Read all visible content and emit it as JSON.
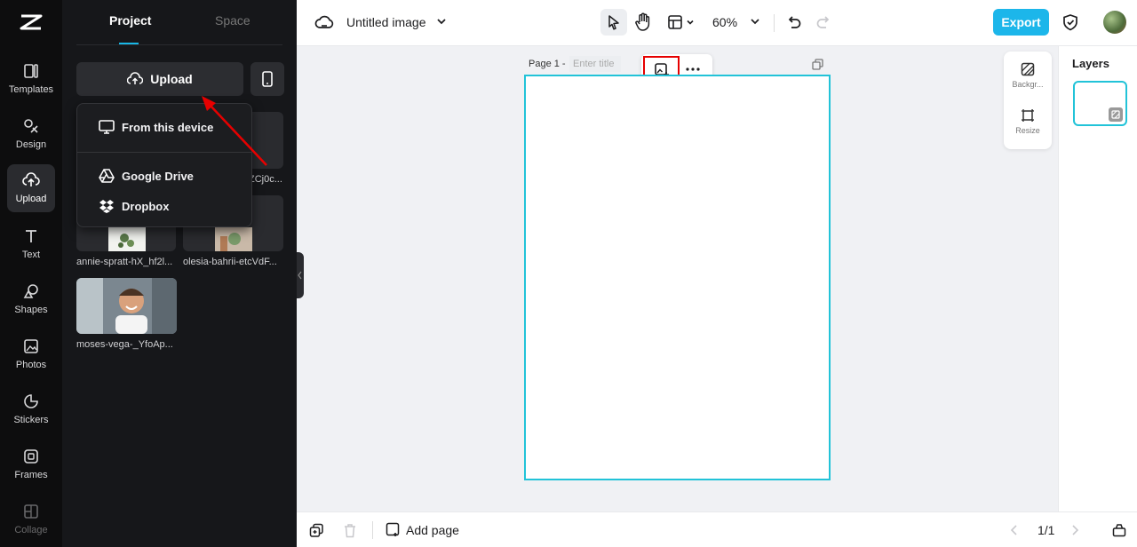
{
  "rail": {
    "items": [
      {
        "label": "Templates",
        "icon": "templates-icon"
      },
      {
        "label": "Design",
        "icon": "design-icon"
      },
      {
        "label": "Upload",
        "icon": "upload-icon",
        "active": true
      },
      {
        "label": "Text",
        "icon": "text-icon"
      },
      {
        "label": "Shapes",
        "icon": "shapes-icon"
      },
      {
        "label": "Photos",
        "icon": "photos-icon"
      },
      {
        "label": "Stickers",
        "icon": "stickers-icon"
      },
      {
        "label": "Frames",
        "icon": "frames-icon"
      },
      {
        "label": "Collage",
        "icon": "collage-icon"
      }
    ]
  },
  "panel": {
    "tabs": {
      "project": "Project",
      "space": "Space"
    },
    "upload_label": "Upload",
    "dropdown": {
      "from_device": "From this device",
      "google_drive": "Google Drive",
      "dropbox": "Dropbox"
    },
    "files": [
      {
        "name": "ZCj0c..."
      },
      {
        "name": "annie-spratt-hX_hf2l..."
      },
      {
        "name": "olesia-bahrii-etcVdF..."
      },
      {
        "name": "moses-vega-_YfoAp..."
      }
    ]
  },
  "topbar": {
    "doc_title": "Untitled image",
    "zoom": "60%",
    "export_label": "Export"
  },
  "canvas": {
    "page_label": "Page 1 -",
    "title_placeholder": "Enter title"
  },
  "side_tools": {
    "background": "Backgr...",
    "resize": "Resize"
  },
  "layers": {
    "title": "Layers"
  },
  "bottombar": {
    "add_page": "Add page",
    "page_count": "1/1"
  },
  "colors": {
    "accent": "#1cb6ea",
    "artboard_border": "#22c3d8",
    "annotation": "#e60000"
  }
}
